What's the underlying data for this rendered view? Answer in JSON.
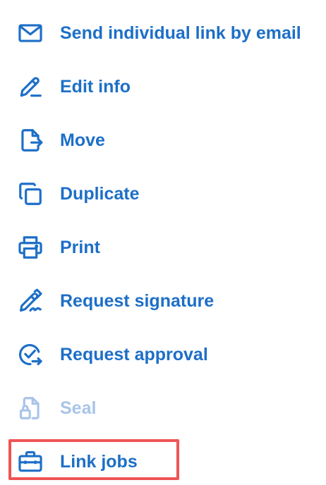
{
  "menu": {
    "items": [
      {
        "label": "Send individual link by email",
        "icon": "mail-icon",
        "disabled": false
      },
      {
        "label": "Edit info",
        "icon": "pencil-icon",
        "disabled": false
      },
      {
        "label": "Move",
        "icon": "file-move-icon",
        "disabled": false
      },
      {
        "label": "Duplicate",
        "icon": "duplicate-icon",
        "disabled": false
      },
      {
        "label": "Print",
        "icon": "printer-icon",
        "disabled": false
      },
      {
        "label": "Request signature",
        "icon": "signature-pen-icon",
        "disabled": false
      },
      {
        "label": "Request approval",
        "icon": "approval-check-icon",
        "disabled": false
      },
      {
        "label": "Seal",
        "icon": "seal-lock-icon",
        "disabled": true
      },
      {
        "label": "Link jobs",
        "icon": "briefcase-icon",
        "disabled": false,
        "highlighted": true
      }
    ]
  },
  "colors": {
    "accent": "#1d6fc7",
    "disabled": "#a9c4e8",
    "highlight": "#f05454"
  }
}
